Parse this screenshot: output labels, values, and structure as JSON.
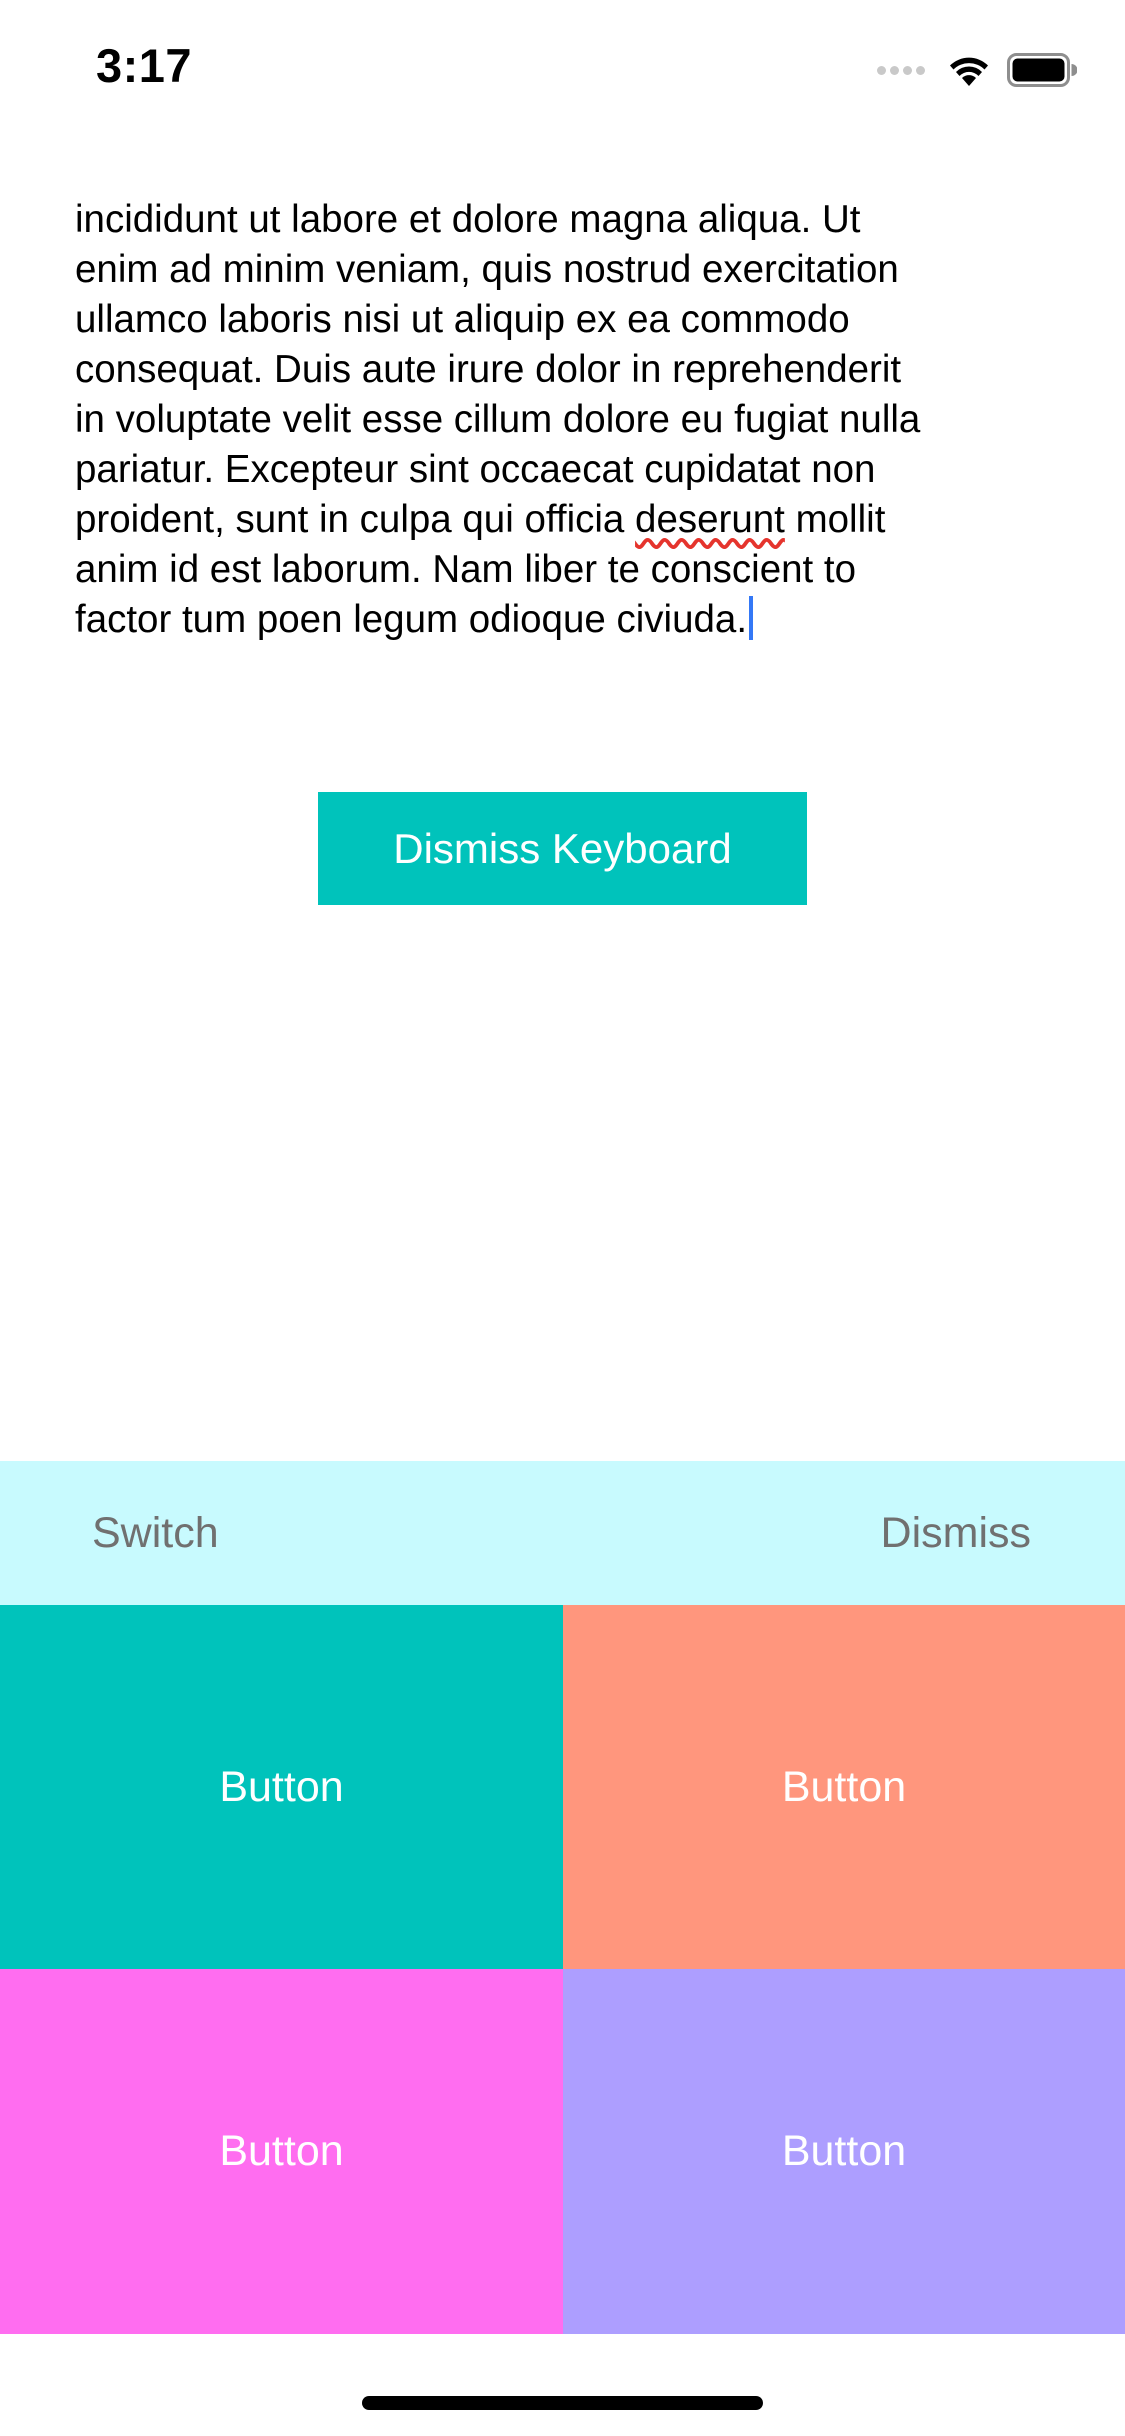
{
  "status_bar": {
    "time": "3:17",
    "icons": [
      "cellular-signal-icon",
      "wifi-icon",
      "battery-icon"
    ]
  },
  "text_view": {
    "lines": [
      "incididunt ut labore et dolore magna aliqua. Ut",
      "enim ad minim veniam, quis nostrud exercitation",
      "ullamco laboris nisi ut aliquip ex ea commodo",
      "consequat. Duis aute irure dolor in reprehenderit",
      "in voluptate velit esse cillum dolore eu fugiat nulla",
      "pariatur. Excepteur sint occaecat cupidatat non"
    ],
    "line7_before": "proident, sunt in culpa qui officia ",
    "line7_misspelled": "deserunt",
    "line7_after": " mollit",
    "line8": "anim id est laborum. Nam liber te conscient to",
    "line9": "factor tum poen legum odioque civiuda."
  },
  "dismiss_keyboard_label": "Dismiss Keyboard",
  "toolbar": {
    "switch_label": "Switch",
    "dismiss_label": "Dismiss"
  },
  "grid": {
    "buttons": [
      {
        "label": "Button",
        "color": "#00c3bb"
      },
      {
        "label": "Button",
        "color": "#ff967d"
      },
      {
        "label": "Button",
        "color": "#ff6df0"
      },
      {
        "label": "Button",
        "color": "#ad9eff"
      }
    ]
  },
  "colors": {
    "accent": "#00c3bb",
    "toolbar_bg": "#c8fafe",
    "caret": "#3478f6"
  }
}
